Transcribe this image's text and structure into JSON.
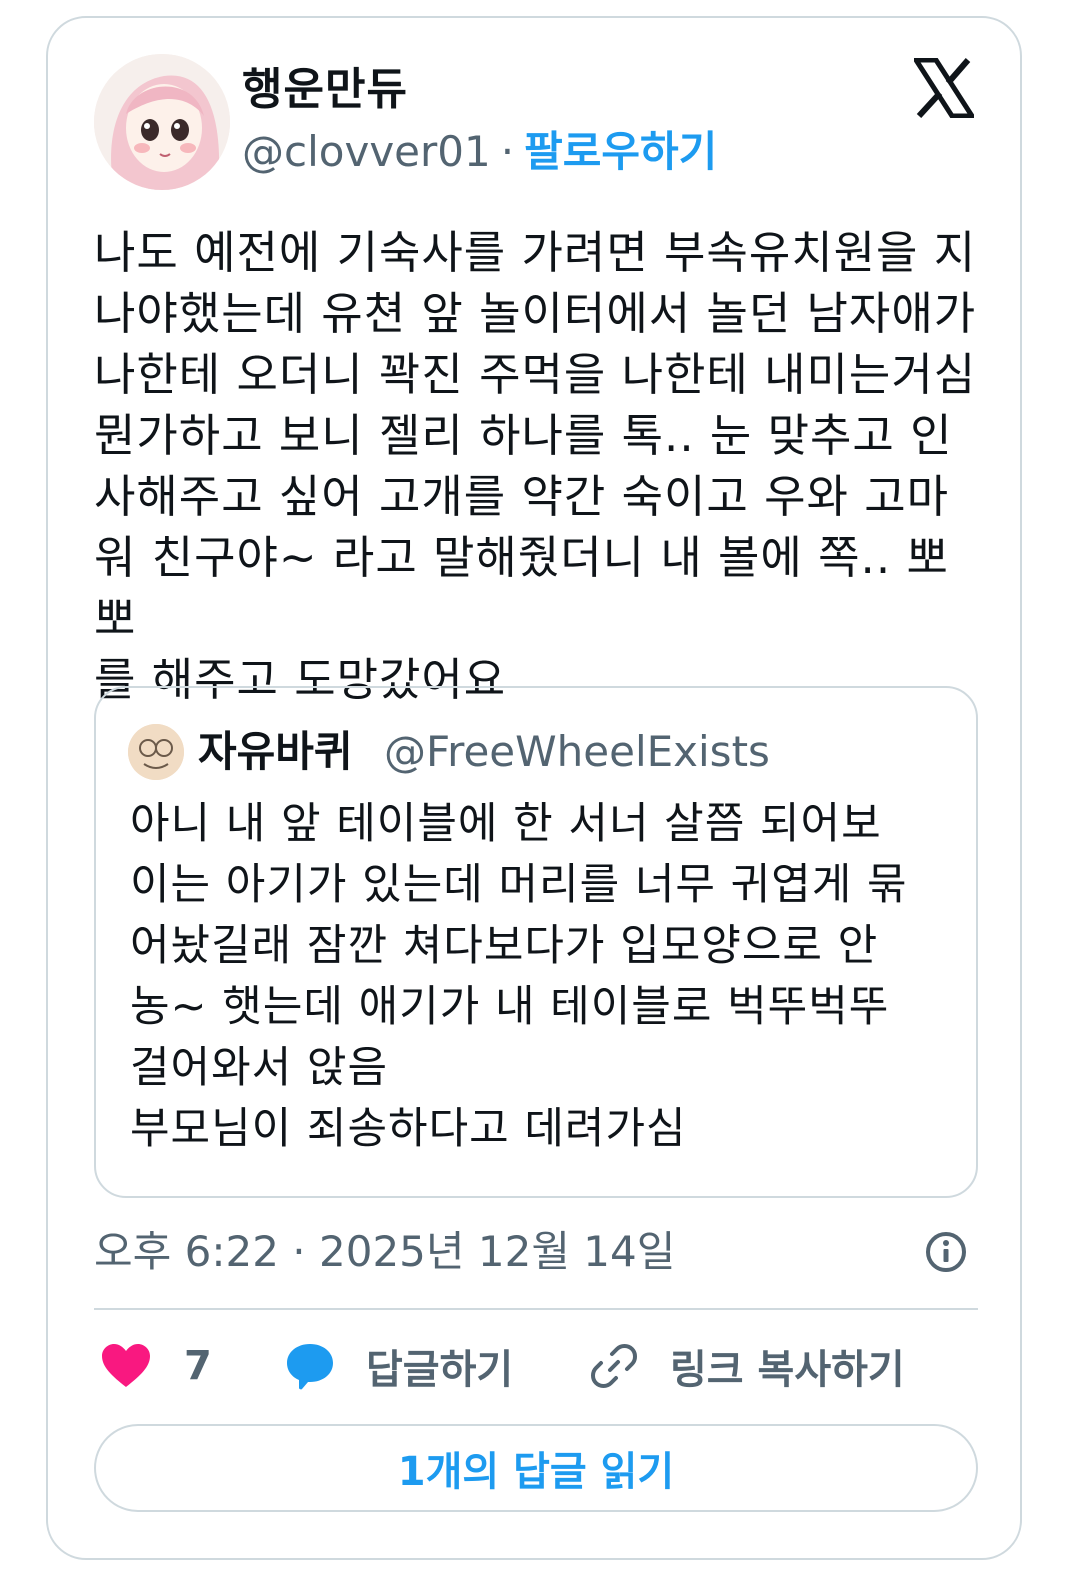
{
  "author": {
    "display_name": "행운만듀",
    "handle": "@clovver01",
    "separator": "·",
    "follow_label": "팔로우하기"
  },
  "icons": {
    "brand": "x-logo-icon",
    "like": "heart-icon",
    "reply": "speech-bubble-icon",
    "link": "link-icon",
    "info": "info-icon"
  },
  "colors": {
    "accent": "#1d9bf0",
    "like": "#f91880",
    "muted": "#536471",
    "border": "#cfd9de"
  },
  "tweet": {
    "text": "나도 예전에 기숙사를 가려면 부속유치원을 지\n나야했는데 유쳔 앞 놀이터에서 놀던 남자애가\n나한테 오더니 꽉진 주먹을 나한테 내미는거심\n뭔가하고 보니 젤리 하나를 톡.. 눈 맞추고 인\n사해주고 싶어 고개를 약간 숙이고 우와 고마\n워 친구야~ 라고 말해줬더니 내 볼에 쪽.. 뽀뽀\n를 해주고 도망갔어요"
  },
  "quote": {
    "display_name": "자유바퀴",
    "handle": "@FreeWheelExists",
    "text": "아니 내 앞 테이블에 한 서너 살쯤 되어보\n이는 아기가 있는데 머리를 너무 귀엽게 묶\n어놨길래 잠깐 쳐다보다가 입모양으로 안\n농~ 햇는데 애기가 내 테이블로 벅뚜벅뚜\n걸어와서 앉음\n부모님이 죄송하다고 데려가심"
  },
  "timestamp": "오후 6:22 · 2025년 12월 14일",
  "actions": {
    "like_count": "7",
    "reply_label": "답글하기",
    "copy_link_label": "링크 복사하기"
  },
  "read_replies_label": "1개의 답글 읽기"
}
